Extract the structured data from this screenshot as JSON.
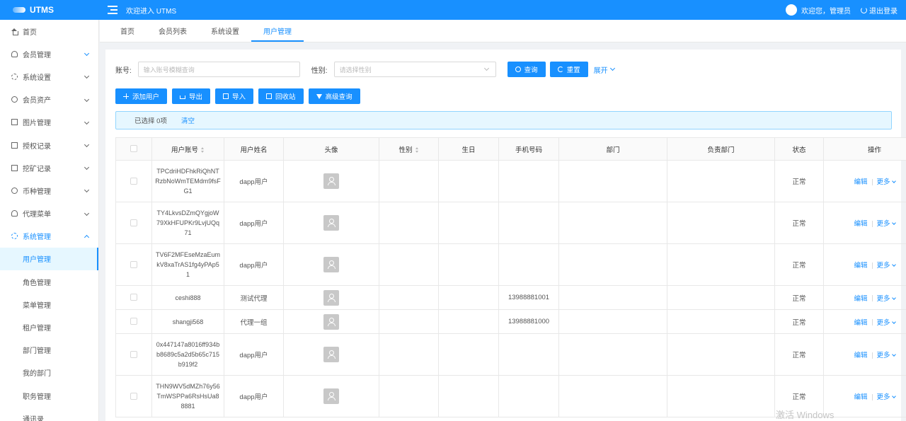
{
  "header": {
    "logo": "UTMS",
    "welcome": "欢迎进入 UTMS",
    "user_greeting": "欢迎您，管理员",
    "logout": "退出登录"
  },
  "sidebar": {
    "items": [
      {
        "label": "首页",
        "icon": "home-icon"
      },
      {
        "label": "会员管理",
        "icon": "user-icon"
      },
      {
        "label": "系统设置",
        "icon": "gear-icon"
      },
      {
        "label": "会员资产",
        "icon": "coin-icon"
      },
      {
        "label": "图片管理",
        "icon": "image-icon"
      },
      {
        "label": "授权记录",
        "icon": "picture-icon"
      },
      {
        "label": "挖矿记录",
        "icon": "record-icon"
      },
      {
        "label": "币种管理",
        "icon": "copyright-icon"
      },
      {
        "label": "代理菜单",
        "icon": "user-icon"
      },
      {
        "label": "系统管理",
        "icon": "gear-icon"
      }
    ],
    "sub_items": [
      "用户管理",
      "角色管理",
      "菜单管理",
      "租户管理",
      "部门管理",
      "我的部门",
      "职务管理",
      "通讯录"
    ]
  },
  "tabs": [
    "首页",
    "会员列表",
    "系统设置",
    "用户管理"
  ],
  "search": {
    "account_label": "账号:",
    "account_placeholder": "输入账号模糊查询",
    "sex_label": "性别:",
    "sex_placeholder": "请选择性别",
    "query": "查询",
    "reset": "重置",
    "expand": "展开"
  },
  "actions": {
    "add": "添加用户",
    "export": "导出",
    "import": "导入",
    "recycle": "回收站",
    "advanced": "高级查询"
  },
  "alert": {
    "selected": "已选择 0项",
    "clear": "清空"
  },
  "table": {
    "headers": [
      "用户账号",
      "用户姓名",
      "头像",
      "性别",
      "生日",
      "手机号码",
      "部门",
      "负责部门",
      "状态",
      "操作"
    ],
    "edit": "编辑",
    "more": "更多",
    "rows": [
      {
        "account": "TPCdriHDFhkRiQhNTRzbNoWmTEMdm9fsFG1",
        "name": "dapp用户",
        "phone": "",
        "status": "正常"
      },
      {
        "account": "TY4LkvsDZmQYgjoW79XkHFUPKr9LvjUQq71",
        "name": "dapp用户",
        "phone": "",
        "status": "正常"
      },
      {
        "account": "TV6F2MFEseMzaEumkV8xaTrAS1fg4yPAp51",
        "name": "dapp用户",
        "phone": "",
        "status": "正常"
      },
      {
        "account": "ceshi888",
        "name": "测试代理",
        "phone": "13988881001",
        "status": "正常"
      },
      {
        "account": "shangji568",
        "name": "代理一组",
        "phone": "13988881000",
        "status": "正常"
      },
      {
        "account": "0x447147a8016ff934bb8689c5a2d5b65c715b919f2",
        "name": "dapp用户",
        "phone": "",
        "status": "正常"
      },
      {
        "account": "THN9WV5dMZh76y56TmWSPPa6RsHsUa88881",
        "name": "dapp用户",
        "phone": "",
        "status": "正常"
      }
    ]
  },
  "watermark": "激活 Windows"
}
